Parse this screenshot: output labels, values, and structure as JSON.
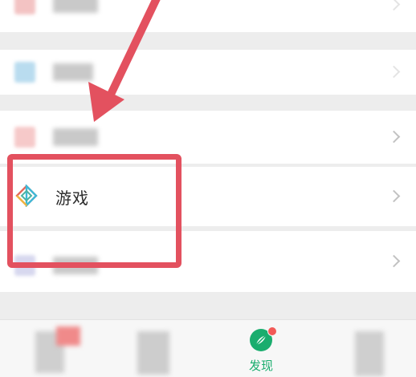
{
  "menu": {
    "items": [
      {
        "label": "",
        "icon": "blurred-icon",
        "color": "#f3c3c3"
      },
      {
        "label": "",
        "icon": "blurred-icon",
        "color": "#b9dcef"
      },
      {
        "label": "",
        "icon": "blurred-icon",
        "color": "#f6c9c9"
      },
      {
        "label": "游戏",
        "icon": "game-diamond-icon"
      },
      {
        "label": "",
        "icon": "blurred-icon",
        "color": "#d7d8ef"
      }
    ]
  },
  "tabbar": {
    "tabs": [
      {
        "label": "",
        "icon": "blurred-chat-icon"
      },
      {
        "label": "",
        "icon": "blurred-contacts-icon"
      },
      {
        "label": "发现",
        "icon": "compass-icon",
        "badge": "red-dot",
        "active": true
      },
      {
        "label": "",
        "icon": "blurred-me-icon"
      }
    ]
  },
  "annotation": {
    "highlight_color": "#e3515f",
    "arrow_color": "#e3515f"
  },
  "colors": {
    "active_tab": "#1aad6e",
    "badge": "#f25a57",
    "background": "#ededed"
  }
}
